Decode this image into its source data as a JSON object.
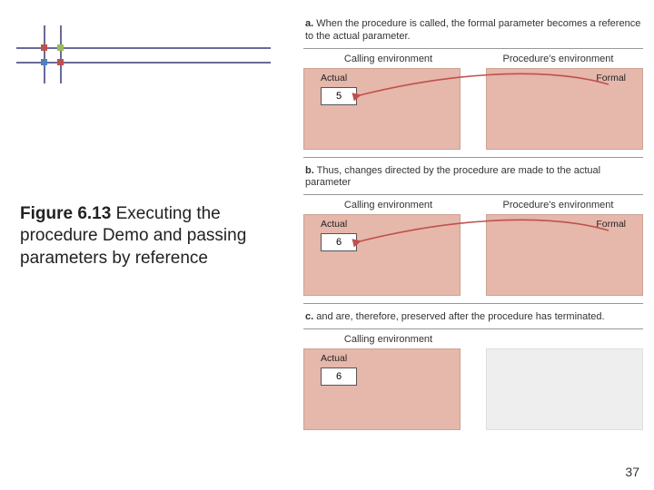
{
  "figure": {
    "label": "Figure 6.13",
    "caption_rest": "  Executing the procedure Demo and passing parameters by reference"
  },
  "page_number": "37",
  "labels": {
    "calling_env": "Calling environment",
    "proc_env": "Procedure's environment",
    "actual": "Actual",
    "formal": "Formal"
  },
  "panels": {
    "a": {
      "lead": "a.",
      "text": " When the procedure is called, the formal parameter becomes a reference to the actual parameter.",
      "actual_value": "5"
    },
    "b": {
      "lead": "b.",
      "text": " Thus, changes directed by the procedure are made to the actual parameter",
      "actual_value": "6"
    },
    "c": {
      "lead": "c.",
      "text": " and are, therefore, preserved after the procedure has terminated.",
      "actual_value": "6"
    }
  },
  "decor_colors": {
    "c1": "#c0504d",
    "c2": "#4f81bd",
    "c3": "#9bbb59"
  }
}
